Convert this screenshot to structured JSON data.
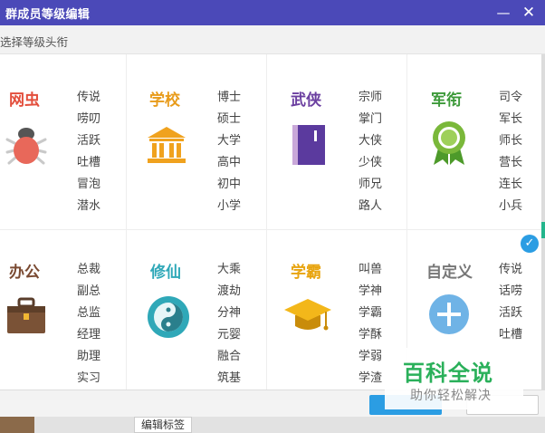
{
  "window": {
    "title": "群成员等级编辑",
    "minimize_glyph": "—",
    "close_glyph": "✕"
  },
  "subtitle": "选择等级头衔",
  "categories": [
    {
      "name": "网虫",
      "color": "#e34f3d",
      "icon": "bug-icon",
      "items": [
        "传说",
        "唠叨",
        "活跃",
        "吐槽",
        "冒泡",
        "潜水"
      ]
    },
    {
      "name": "学校",
      "color": "#e89b1a",
      "icon": "school-building-icon",
      "items": [
        "博士",
        "硕士",
        "大学",
        "高中",
        "初中",
        "小学"
      ]
    },
    {
      "name": "武侠",
      "color": "#6b3fa0",
      "icon": "book-icon",
      "items": [
        "宗师",
        "掌门",
        "大侠",
        "少侠",
        "师兄",
        "路人"
      ]
    },
    {
      "name": "军衔",
      "color": "#3d9a3a",
      "icon": "medal-icon",
      "items": [
        "司令",
        "军长",
        "师长",
        "营长",
        "连长",
        "小兵"
      ]
    },
    {
      "name": "办公",
      "color": "#7a4a32",
      "icon": "briefcase-icon",
      "items": [
        "总裁",
        "副总",
        "总监",
        "经理",
        "助理",
        "实习"
      ]
    },
    {
      "name": "修仙",
      "color": "#2fa8b8",
      "icon": "yin-yang-icon",
      "items": [
        "大乘",
        "渡劫",
        "分神",
        "元婴",
        "融合",
        "筑基"
      ]
    },
    {
      "name": "学霸",
      "color": "#e8a40f",
      "icon": "graduation-cap-icon",
      "items": [
        "叫兽",
        "学神",
        "学霸",
        "学酥",
        "学弱",
        "学渣"
      ]
    },
    {
      "name": "自定义",
      "color": "#777777",
      "icon": "plus-circle-icon",
      "items": [
        "传说",
        "话唠",
        "活跃",
        "吐槽"
      ]
    }
  ],
  "selected_category": "自定义",
  "bottom": {
    "tag_label": "编辑标签"
  },
  "watermark": {
    "main": "百科全说",
    "sub": "助你轻松解决"
  }
}
